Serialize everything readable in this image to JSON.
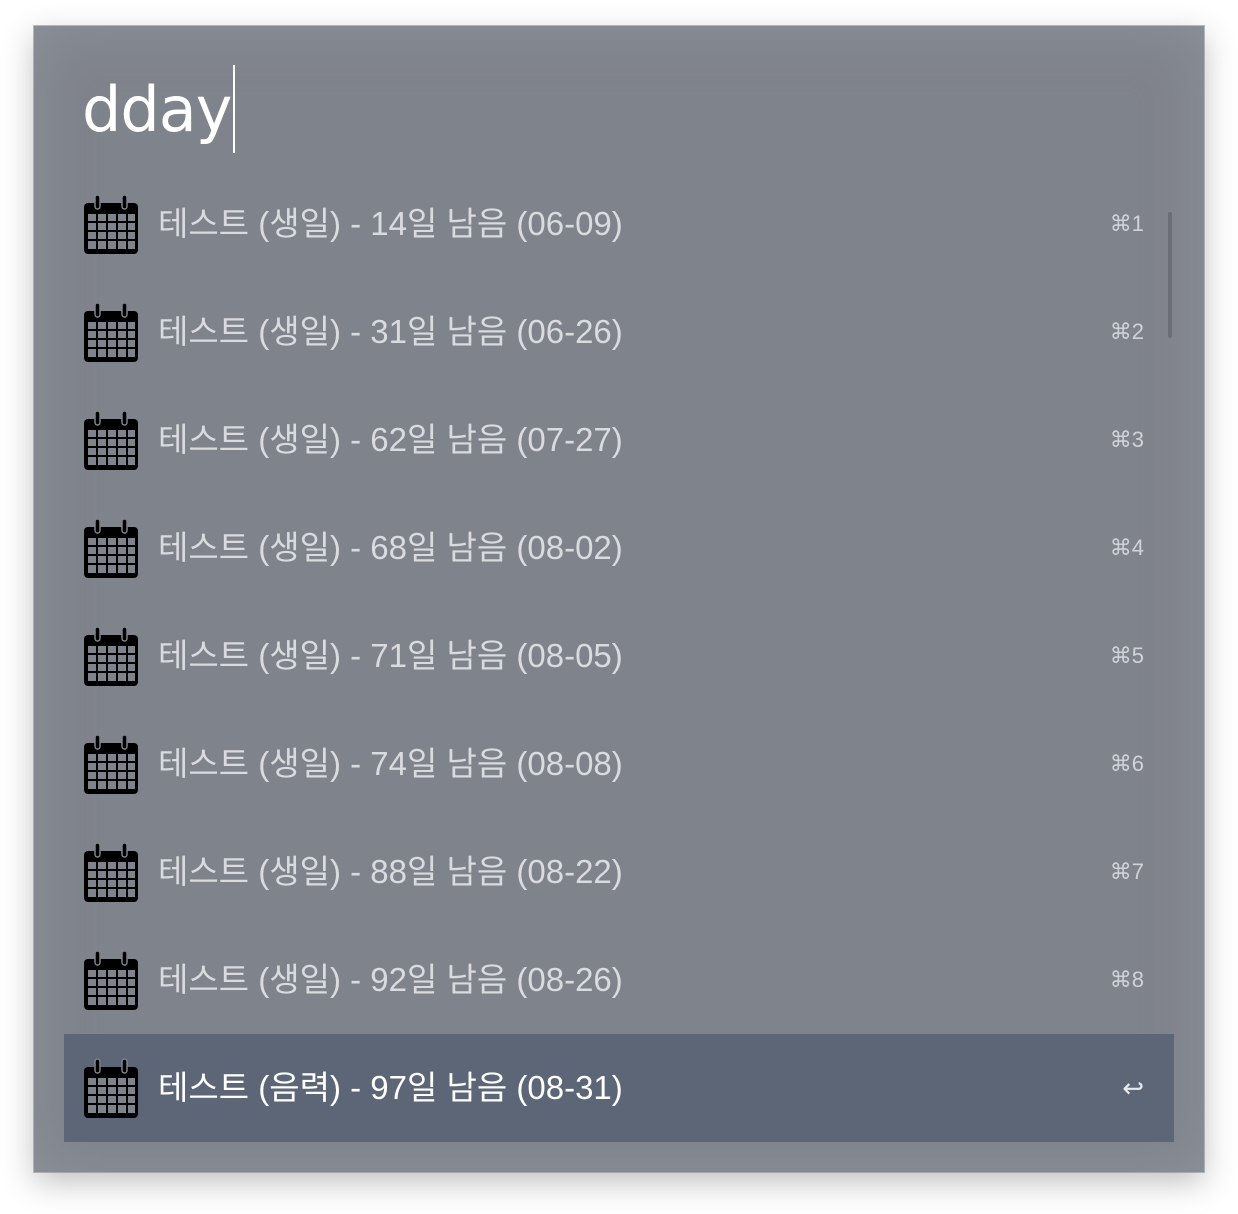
{
  "search": {
    "query": "dday"
  },
  "results": [
    {
      "label": "테스트 (생일) - 14일 남음 (06-09)",
      "shortcut": "⌘1",
      "icon": "calendar-icon"
    },
    {
      "label": "테스트 (생일) - 31일 남음 (06-26)",
      "shortcut": "⌘2",
      "icon": "calendar-icon"
    },
    {
      "label": "테스트 (생일) - 62일 남음 (07-27)",
      "shortcut": "⌘3",
      "icon": "calendar-icon"
    },
    {
      "label": "테스트 (생일) - 68일 남음 (08-02)",
      "shortcut": "⌘4",
      "icon": "calendar-icon"
    },
    {
      "label": "테스트 (생일) - 71일 남음 (08-05)",
      "shortcut": "⌘5",
      "icon": "calendar-icon"
    },
    {
      "label": "테스트 (생일) - 74일 남음 (08-08)",
      "shortcut": "⌘6",
      "icon": "calendar-icon"
    },
    {
      "label": "테스트 (생일) - 88일 남음 (08-22)",
      "shortcut": "⌘7",
      "icon": "calendar-icon"
    },
    {
      "label": "테스트 (생일) - 92일 남음 (08-26)",
      "shortcut": "⌘8",
      "icon": "calendar-icon"
    },
    {
      "label": "테스트 (음력) - 97일 남음 (08-31)",
      "shortcut": "↩",
      "icon": "calendar-icon",
      "selected": true
    }
  ],
  "colors": {
    "panel_background": "#7f838b",
    "selected_row": "#5d6677",
    "text_primary": "#ffffff",
    "text_secondary": "#d9dbdf"
  }
}
